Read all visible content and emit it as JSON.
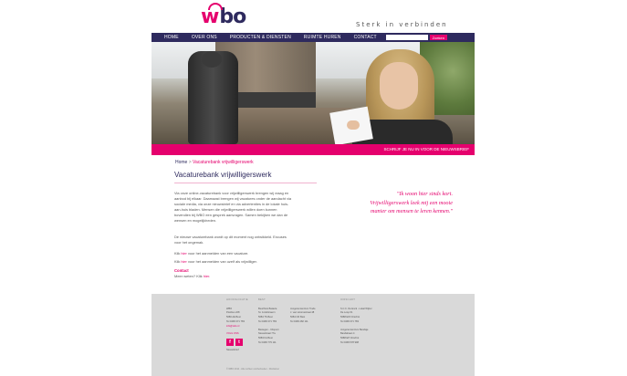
{
  "header": {
    "logo_text_w": "w",
    "logo_text_bo": "bo",
    "tagline": "Sterk in verbinden"
  },
  "nav": {
    "items": [
      {
        "label": "HOME"
      },
      {
        "label": "OVER ONS"
      },
      {
        "label": "PRODUCTEN & DIENSTEN"
      },
      {
        "label": "RUIMTE HUREN"
      },
      {
        "label": "CONTACT"
      }
    ],
    "search_placeholder": "",
    "search_button": "Zoeken"
  },
  "hero": {
    "banner_link": "SCHRIJF JE NU IN VOOR DE NIEUWSBRIEF"
  },
  "breadcrumb": {
    "home": "Home",
    "separator": " > ",
    "current": "Vacaturebank vrijwilligerswerk"
  },
  "main": {
    "title": "Vacaturebank vrijwilligerswerk",
    "paragraph1": "Via onze online-vacaturebank voor vrijwilligerswerk brengen wij vraag en aanbod bij elkaar. Daarnaast brengen wij vacatures onder de aandacht via sociale media, via onze nieuwsbrief en via advertenties in de lokale huis-aan-huis bladen. Mensen die vrijwilligerswerk willen doen kunnen bovendien bij WBO een gesprek aanvragen. Samen bekijken we dan de wensen en mogelijkheden.",
    "paragraph2": "De nieuwe vacaturebank wordt op dit moment nog ontwikkeld. Excuses voor het ongemak.",
    "p3_prefix": "Klik ",
    "p3_link": "hier",
    "p3_suffix": " voor het aanmelden van een vacature.",
    "p4_prefix": "Klik ",
    "p4_link": "hier",
    "p4_suffix": " voor het aanmelden van uzelf als vrijwilliger.",
    "contact_heading": "Contact",
    "contact_prefix": "Meer weten? Klik ",
    "contact_link": "hier",
    "contact_suffix": "."
  },
  "quote": {
    "text": "\"Ik woon hier sinds kort. Vrijwilligerswerk leek mij een mooie manier om mensen te leren kennen.\""
  },
  "footer": {
    "col1": {
      "heading": "Hoofdlocatie",
      "lines": [
        "WBO",
        "Postbus 228",
        "5680 AE Best",
        "Tel 0499 371 783",
        "info@wbo.nl"
      ],
      "follow": "Volg ons",
      "facebook": "f",
      "twitter": "t",
      "newsletter": "Nieuwsbrief"
    },
    "col2": {
      "heading": "Best",
      "lines": [
        "Buurthuis Batavia",
        "St. Jozefstraat 1",
        "5684 TS Best",
        "Tel 0499 371 783"
      ],
      "lines2": [
        "Bewegen - Infopunt",
        "Nieuwstraat 77a",
        "5683 KA Best",
        "Tel 0499 779 111"
      ]
    },
    "col3": {
      "heading": "",
      "lines": [
        "Jongerencentrum Trude",
        "J. van Hoornestraat 48",
        "5684 CR Best",
        "Tel 0499 482 111"
      ]
    },
    "col4": {
      "heading": "Oirschot",
      "lines": [
        "S.C.C. De Enck - Lokal Wijzer",
        "De Loop 61",
        "5688 EW Oirschot",
        "Tel 0499 371 783"
      ],
      "lines2": [
        "Jongerencentrum Bandaje",
        "Bandabaan 4",
        "5688 EP Oirschot",
        "Tel 0499 578 998"
      ]
    },
    "copyright": "© WBO 2014 - Alle rechten voorbehouden - Disclaimer"
  },
  "colors": {
    "brand_pink": "#e5006d",
    "brand_navy": "#2e2a5e",
    "footer_bg": "#d9d9d9"
  }
}
